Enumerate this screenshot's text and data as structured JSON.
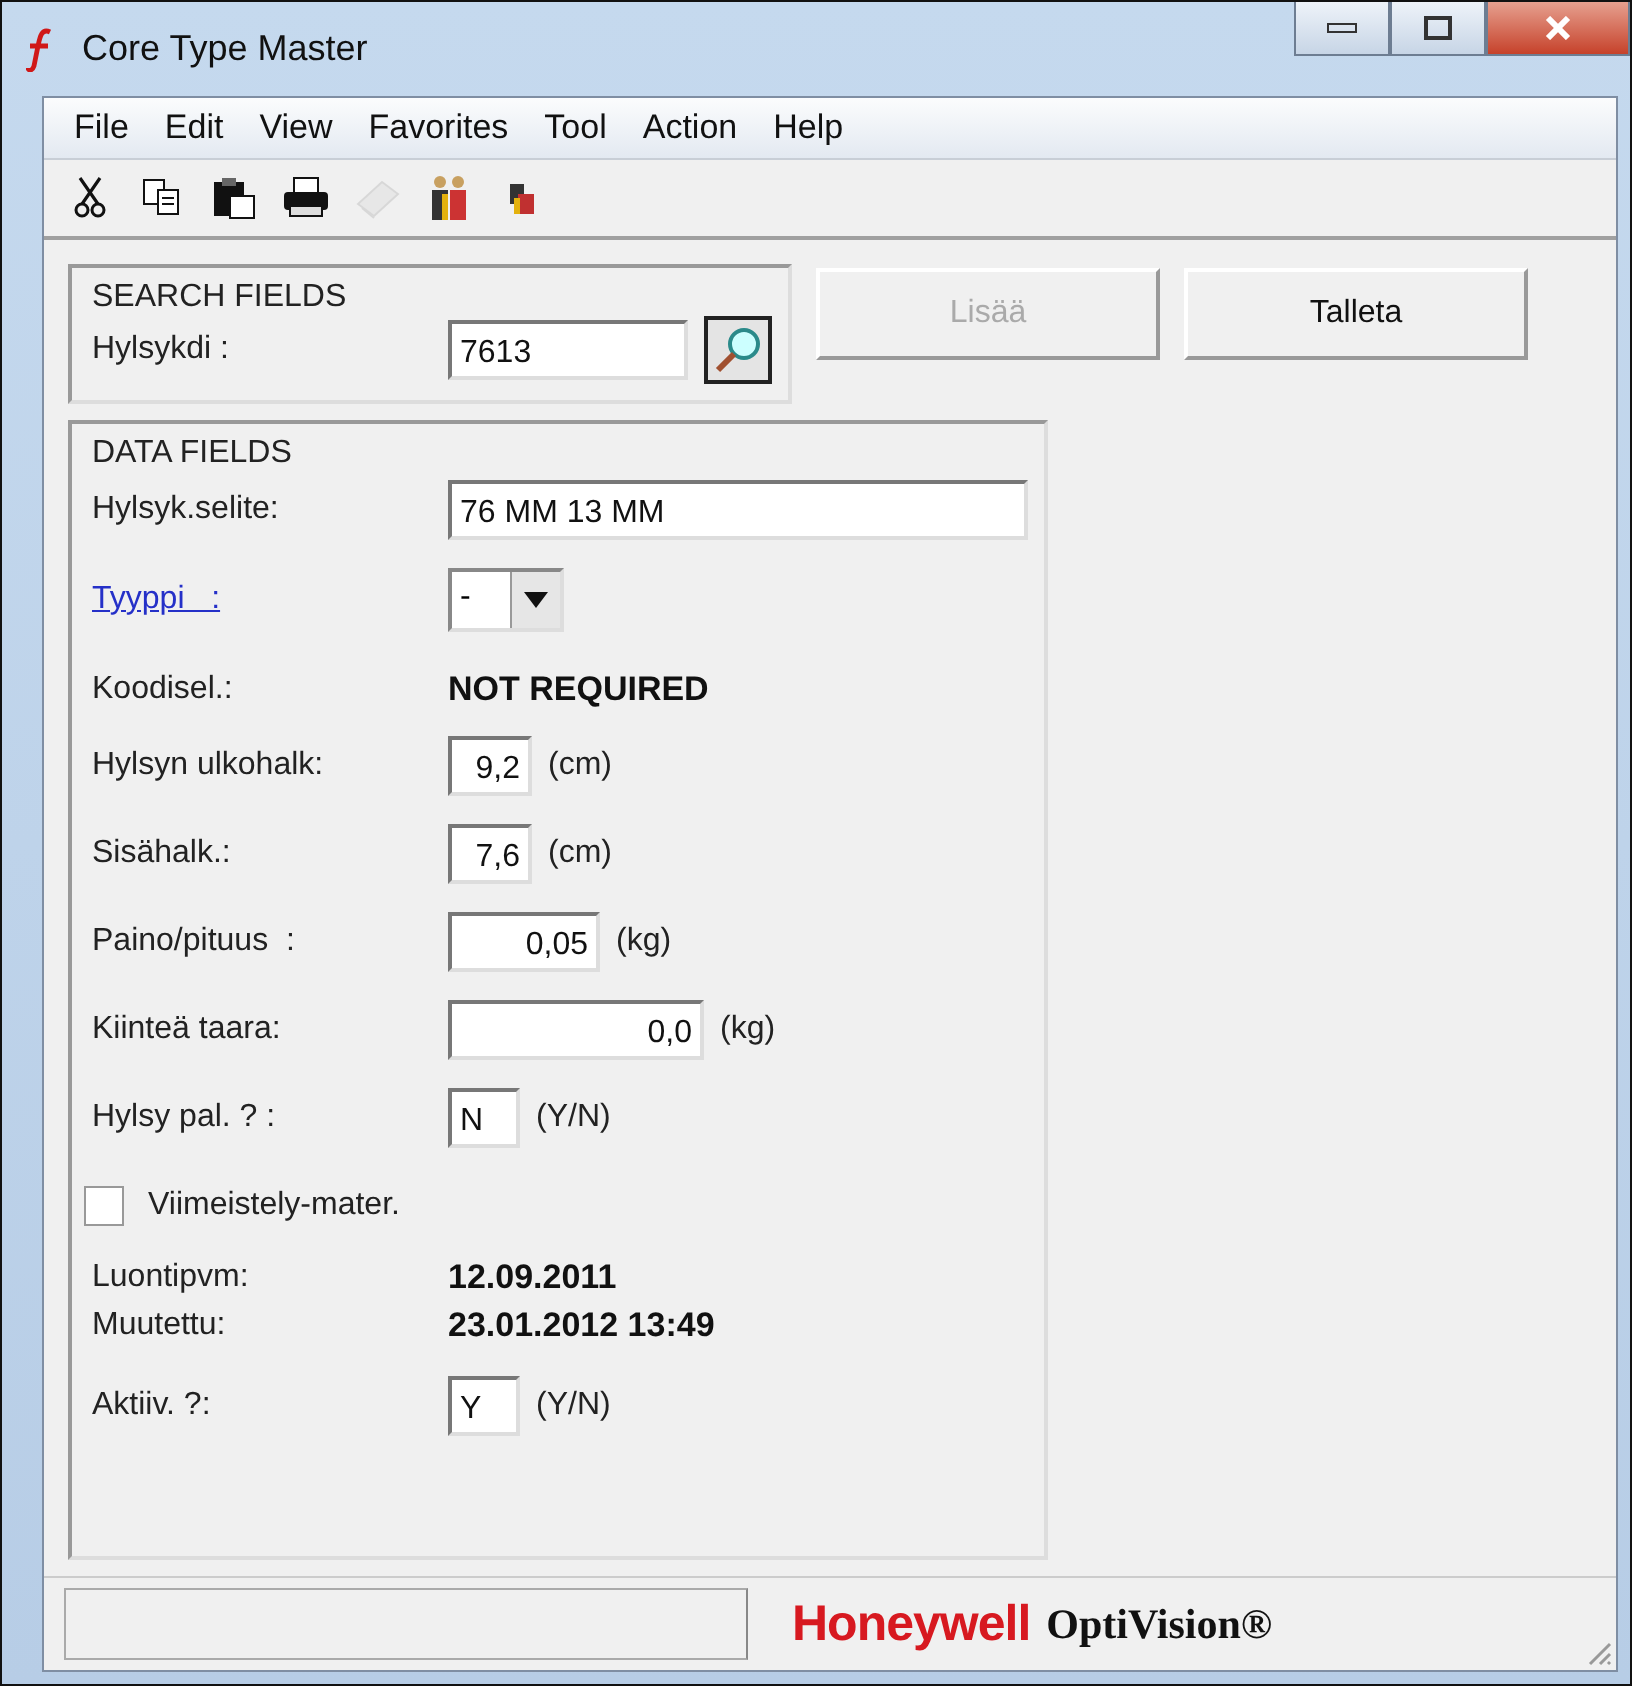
{
  "window": {
    "title": "Core Type Master"
  },
  "menu": [
    "File",
    "Edit",
    "View",
    "Favorites",
    "Tool",
    "Action",
    "Help"
  ],
  "toolbar": [
    {
      "kind": "cut",
      "disabled": false
    },
    {
      "kind": "copy",
      "disabled": false
    },
    {
      "kind": "paste",
      "disabled": false
    },
    {
      "kind": "print",
      "disabled": false
    },
    {
      "kind": "book",
      "disabled": true
    },
    {
      "kind": "people",
      "disabled": false
    },
    {
      "kind": "box",
      "disabled": false
    }
  ],
  "search_fields": {
    "title": "SEARCH FIELDS",
    "label": "Hylsykdi :",
    "value": "7613"
  },
  "buttons": [
    {
      "label": "Lisää",
      "disabled": true
    },
    {
      "label": "Talleta",
      "disabled": false
    }
  ],
  "data_fields": {
    "title": "DATA FIELDS",
    "rows": [
      {
        "kind": "input",
        "label": "Hylsyk.selite:",
        "value": "76 MM 13 MM"
      },
      {
        "kind": "dropdown",
        "label": "Tyyppi   :",
        "value": "-"
      },
      {
        "kind": "static",
        "label": "Koodisel.:",
        "value": "NOT REQUIRED"
      },
      {
        "kind": "input",
        "label": "Hylsyn ulkohalk:",
        "value": "9,2",
        "unit": "(cm)"
      },
      {
        "kind": "input",
        "label": "Sisähalk.:",
        "value": "7,6",
        "unit": "(cm)"
      },
      {
        "kind": "input",
        "label": "Paino/pituus  :",
        "value": "0,05",
        "unit": "(kg)"
      },
      {
        "kind": "input",
        "label": "Kiinteä taara:",
        "value": "0,0",
        "unit": "(kg)"
      },
      {
        "kind": "input",
        "label": "Hylsy pal. ? :",
        "value": "N",
        "unit": "(Y/N)"
      },
      {
        "kind": "checkbox",
        "label": "Viimeistely-mater.",
        "checked": false
      },
      {
        "kind": "static",
        "label": "Luontipvm:",
        "value": "12.09.2011"
      },
      {
        "kind": "static",
        "label": "Muutettu:",
        "value": "23.01.2012 13:49"
      },
      {
        "kind": "input",
        "label": "Aktiiv. ?:",
        "value": "Y",
        "unit": "(Y/N)"
      }
    ]
  },
  "status_bar": {
    "brand": "Honeywell",
    "product": "OptiVision®"
  }
}
